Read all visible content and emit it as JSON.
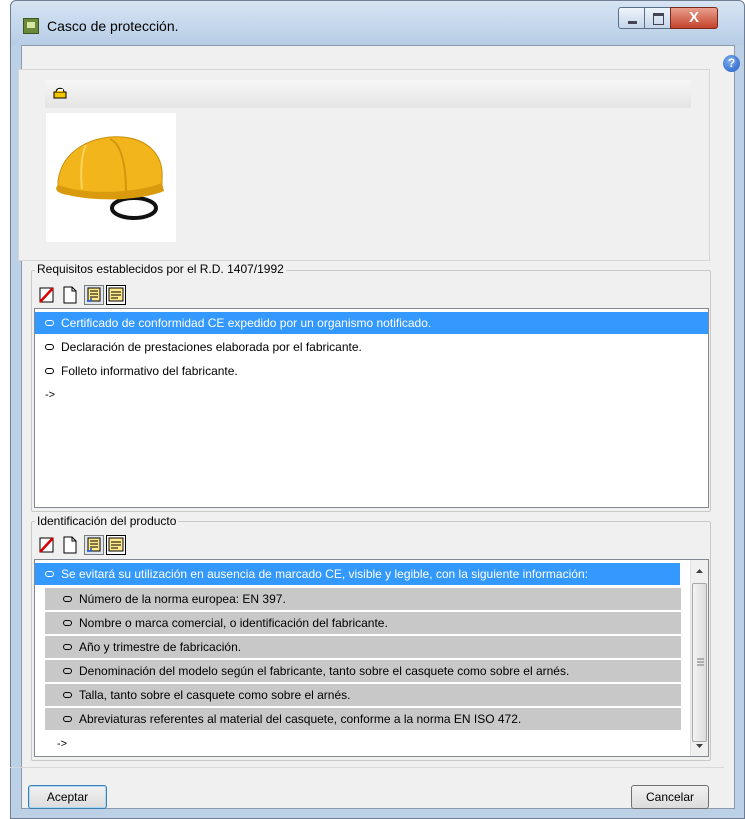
{
  "window": {
    "title": "Casco de protección.",
    "close_glyph": "X"
  },
  "help": {
    "glyph": "?"
  },
  "image_panel": {
    "load_icon": "load-image-icon",
    "image_icon": "safety-helmet-image"
  },
  "requirements": {
    "label": "Requisitos establecidos por el R.D. 1407/1992",
    "toolbar_icons": [
      "delete-icon",
      "new-document-icon",
      "list-view-icon",
      "text-view-icon"
    ],
    "items": [
      "Certificado de conformidad CE expedido por un organismo notificado.",
      "Declaración de prestaciones elaborada por el fabricante.",
      "Folleto informativo del fabricante."
    ],
    "arrow": "->"
  },
  "identification": {
    "label": "Identificación del producto",
    "toolbar_icons": [
      "delete-icon",
      "new-document-icon",
      "list-view-icon",
      "text-view-icon"
    ],
    "main_item": "Se evitará su utilización en ausencia de marcado CE, visible y legible, con la siguiente información:",
    "sub_items": [
      "Número de la norma europea: EN 397.",
      "Nombre o marca comercial, o identificación del fabricante.",
      "Año y trimestre de fabricación.",
      "Denominación del modelo según el fabricante, tanto sobre el casquete como sobre el arnés.",
      "Talla, tanto sobre el casquete como sobre el arnés.",
      "Abreviaturas referentes al material del casquete, conforme a la norma EN ISO 472."
    ],
    "arrow": "->"
  },
  "buttons": {
    "accept": "Aceptar",
    "cancel": "Cancelar"
  },
  "colors": {
    "selection": "#3399ff",
    "sub_row": "#c8c8c8",
    "helmet": "#f2b51b"
  }
}
